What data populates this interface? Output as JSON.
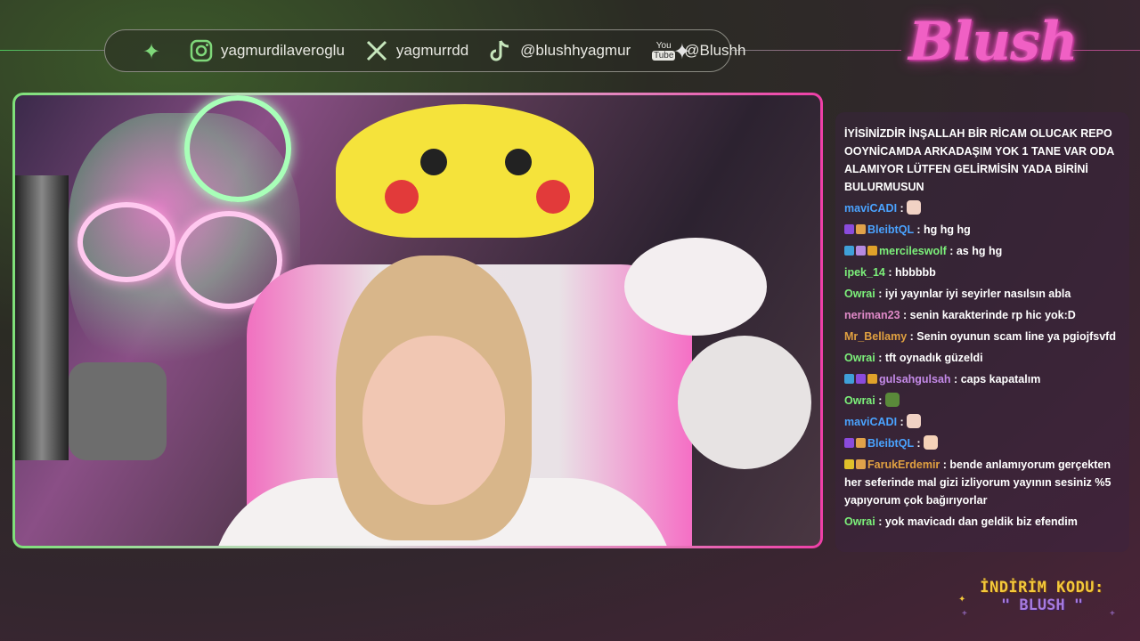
{
  "social": {
    "instagram": "yagmurdilaveroglu",
    "x": "yagmurrdd",
    "tiktok": "@blushhyagmur",
    "youtube_badge_top": "You",
    "youtube_badge_bottom": "Tube",
    "youtube": "@Blushh"
  },
  "logo": "Blush",
  "chat": [
    {
      "user": "",
      "text": "İYİSİNİZDİR İNŞALLAH BİR RİCAM OLUCAK REPO OOYNİCAMDA ARKADAŞIM YOK 1 TANE VAR ODA ALAMIYOR LÜTFEN GELİRMİSİN YADA BİRİNİ BULURMUSUN",
      "color": "#ffffff",
      "badges": []
    },
    {
      "user": "maviCADI",
      "text": "",
      "color": "#4aa3ff",
      "badges": [],
      "emote": "#f1d2c4"
    },
    {
      "user": "BleibtQL",
      "text": "hg hg hg",
      "color": "#4aa3ff",
      "badges": [
        "#8a4bdc",
        "#e0a24a"
      ]
    },
    {
      "user": "mercileswolf",
      "text": "as hg hg",
      "color": "#7cf07a",
      "badges": [
        "#3fa0d8",
        "#b58ae0",
        "#e0a22a"
      ]
    },
    {
      "user": "ipek_14",
      "text": "hbbbbb",
      "color": "#7cf07a",
      "badges": []
    },
    {
      "user": "Owrai",
      "text": "iyi yayınlar iyi seyirler nasılsın abla",
      "color": "#7cf07a",
      "badges": []
    },
    {
      "user": "neriman23",
      "text": "senin karakterinde rp hic yok:D",
      "color": "#e08ac8",
      "badges": []
    },
    {
      "user": "Mr_Bellamy",
      "text": "Senin oyunun scam line ya pgiojfsvfd",
      "color": "#e0a040",
      "badges": []
    },
    {
      "user": "Owrai",
      "text": "tft oynadık güzeldi",
      "color": "#7cf07a",
      "badges": []
    },
    {
      "user": "gulsahgulsah",
      "text": "caps kapatalım",
      "color": "#c48ae8",
      "badges": [
        "#3fa0d8",
        "#8a4bdc",
        "#e0a22a"
      ]
    },
    {
      "user": "Owrai",
      "text": "",
      "color": "#7cf07a",
      "badges": [],
      "emote": "#5a8a3a"
    },
    {
      "user": "maviCADI",
      "text": "",
      "color": "#4aa3ff",
      "badges": [],
      "emote": "#f1d2c4"
    },
    {
      "user": "BleibtQL",
      "text": "",
      "color": "#4aa3ff",
      "badges": [
        "#8a4bdc",
        "#e0a24a"
      ],
      "emote": "#f5d2b8"
    },
    {
      "user": "FarukErdemir",
      "text": "bende anlamıyorum gerçekten her seferinde mal gizi izliyorum yayının sesiniz %5 yapıyorum çok bağırıyorlar",
      "color": "#e0a040",
      "badges": [
        "#e0c02a",
        "#e0a24a"
      ]
    },
    {
      "user": "Owrai",
      "text": "yok mavicadı dan geldik biz efendim",
      "color": "#7cf07a",
      "badges": []
    }
  ],
  "promo": {
    "line1": "İNDİRİM KODU:",
    "line2": "\" BLUSH \""
  }
}
